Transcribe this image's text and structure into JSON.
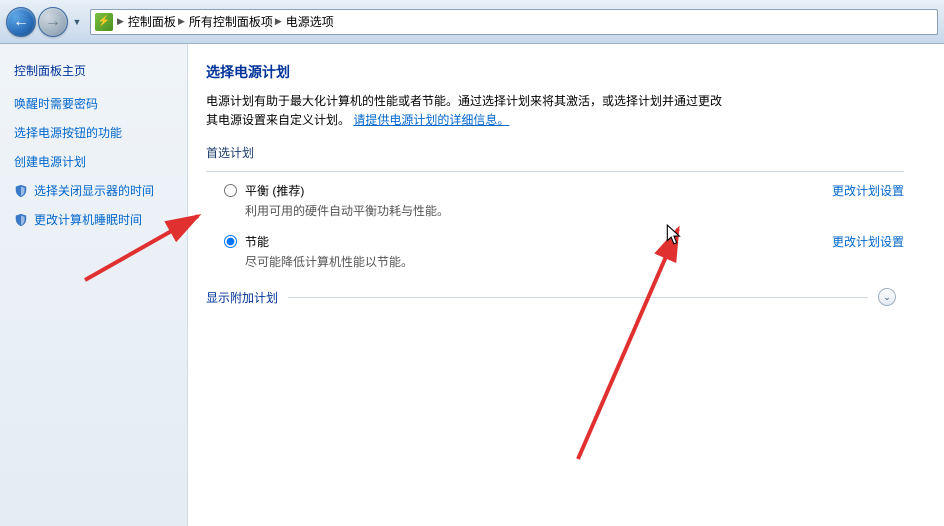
{
  "breadcrumbs": {
    "seg1": "控制面板",
    "seg2": "所有控制面板项",
    "seg3": "电源选项"
  },
  "sidebar": {
    "title": "控制面板主页",
    "links": {
      "wake_password": "唤醒时需要密码",
      "power_button": "选择电源按钮的功能",
      "create_plan": "创建电源计划",
      "display_off": "选择关闭显示器的时间",
      "sleep_time": "更改计算机睡眠时间"
    }
  },
  "main": {
    "title": "选择电源计划",
    "desc_part1": "电源计划有助于最大化计算机的性能或者节能。通过选择计划来将其激活，或选择计划并通过更改其电源设置来自定义计划。",
    "desc_link": "请提供电源计划的详细信息。",
    "section_preferred": "首选计划",
    "plans": {
      "balanced": {
        "name": "平衡 (推荐)",
        "sub": "利用可用的硬件自动平衡功耗与性能。",
        "link": "更改计划设置"
      },
      "saver": {
        "name": "节能",
        "sub": "尽可能降低计算机性能以节能。",
        "link": "更改计划设置"
      }
    },
    "expander_label": "显示附加计划",
    "selected_plan": "saver"
  }
}
